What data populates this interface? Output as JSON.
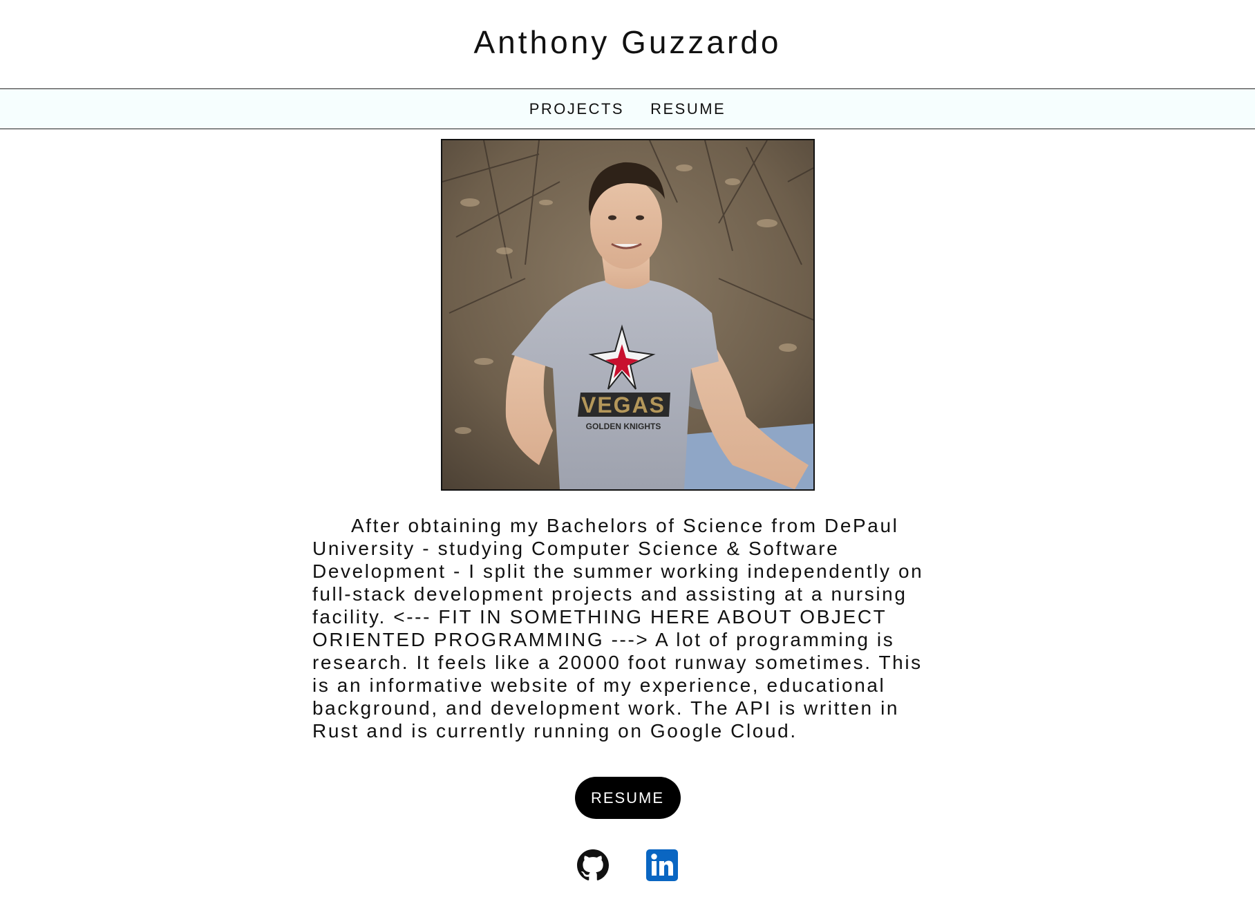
{
  "header": {
    "title": "Anthony Guzzardo"
  },
  "nav": {
    "items": [
      {
        "label": "PROJECTS"
      },
      {
        "label": "RESUME"
      }
    ]
  },
  "profile": {
    "photo_alt": "profile-photo"
  },
  "bio": {
    "text": "After obtaining my Bachelors of Science from DePaul University - studying Computer Science & Software Development - I split the summer working independently on full-stack development projects and assisting at a nursing facility. <--- FIT IN SOMETHING HERE ABOUT OBJECT ORIENTED PROGRAMMING ---> A lot of programming is research. It feels like a 20000 foot runway sometimes. This is an informative website of my experience, educational background, and development work. The API is written in Rust and is currently running on Google Cloud."
  },
  "actions": {
    "resume_label": "RESUME"
  },
  "social": {
    "icons": [
      "github-icon",
      "linkedin-icon"
    ],
    "linkedin_color": "#0a66c2"
  },
  "shirt": {
    "logo_line1": "VEGAS",
    "logo_line2": "GOLDEN KNIGHTS"
  }
}
